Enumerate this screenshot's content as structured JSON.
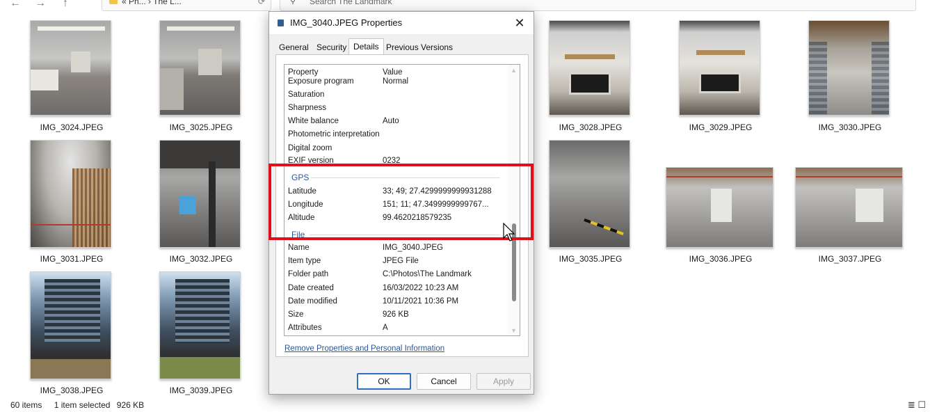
{
  "address_bar": {
    "path_text": "« Ph... › The L...",
    "search_placeholder": "Search The Landmark",
    "nav_back": "←",
    "nav_forward": "→",
    "nav_up": "↑",
    "refresh": "⟳"
  },
  "thumbnails": [
    {
      "label": "IMG_3024.JPEG"
    },
    {
      "label": "IMG_3025.JPEG"
    },
    {
      "label": "IMG_3028.JPEG"
    },
    {
      "label": "IMG_3029.JPEG"
    },
    {
      "label": "IMG_3030.JPEG"
    },
    {
      "label": "IMG_3031.JPEG"
    },
    {
      "label": "IMG_3032.JPEG"
    },
    {
      "label": "IMG_3035.JPEG"
    },
    {
      "label": "IMG_3036.JPEG"
    },
    {
      "label": "IMG_3037.JPEG"
    },
    {
      "label": "IMG_3038.JPEG"
    },
    {
      "label": "IMG_3039.JPEG"
    }
  ],
  "status_bar": {
    "item_count": "60 items",
    "selection": "1 item selected",
    "size": "926 KB"
  },
  "dialog": {
    "title": "IMG_3040.JPEG Properties",
    "close_glyph": "✕",
    "tabs": [
      "General",
      "Security",
      "Details",
      "Previous Versions"
    ],
    "active_tab": "Details",
    "columns": {
      "property": "Property",
      "value": "Value"
    },
    "rows_camera": [
      {
        "k": "Exposure program",
        "v": "Normal"
      },
      {
        "k": "Saturation",
        "v": ""
      },
      {
        "k": "Sharpness",
        "v": ""
      },
      {
        "k": "White balance",
        "v": "Auto"
      },
      {
        "k": "Photometric interpretation",
        "v": ""
      },
      {
        "k": "Digital zoom",
        "v": ""
      },
      {
        "k": "EXIF version",
        "v": "0232"
      }
    ],
    "gps_heading": "GPS",
    "rows_gps": [
      {
        "k": "Latitude",
        "v": "33; 49; 27.4299999999931288"
      },
      {
        "k": "Longitude",
        "v": "151; 11; 47.3499999999767..."
      },
      {
        "k": "Altitude",
        "v": "99.4620218579235"
      }
    ],
    "file_heading": "File",
    "rows_file": [
      {
        "k": "Name",
        "v": "IMG_3040.JPEG"
      },
      {
        "k": "Item type",
        "v": "JPEG File"
      },
      {
        "k": "Folder path",
        "v": "C:\\Photos\\The Landmark"
      },
      {
        "k": "Date created",
        "v": "16/03/2022 10:23 AM"
      },
      {
        "k": "Date modified",
        "v": "10/11/2021 10:36 PM"
      },
      {
        "k": "Size",
        "v": "926 KB"
      },
      {
        "k": "Attributes",
        "v": "A"
      }
    ],
    "remove_link": "Remove Properties and Personal Information",
    "buttons": {
      "ok": "OK",
      "cancel": "Cancel",
      "apply": "Apply"
    }
  },
  "colors": {
    "highlight": "#e0101a",
    "link": "#2b5797",
    "group_heading": "#2b5797"
  },
  "icons": {
    "view_details": "≣",
    "view_tiles": "☐"
  }
}
